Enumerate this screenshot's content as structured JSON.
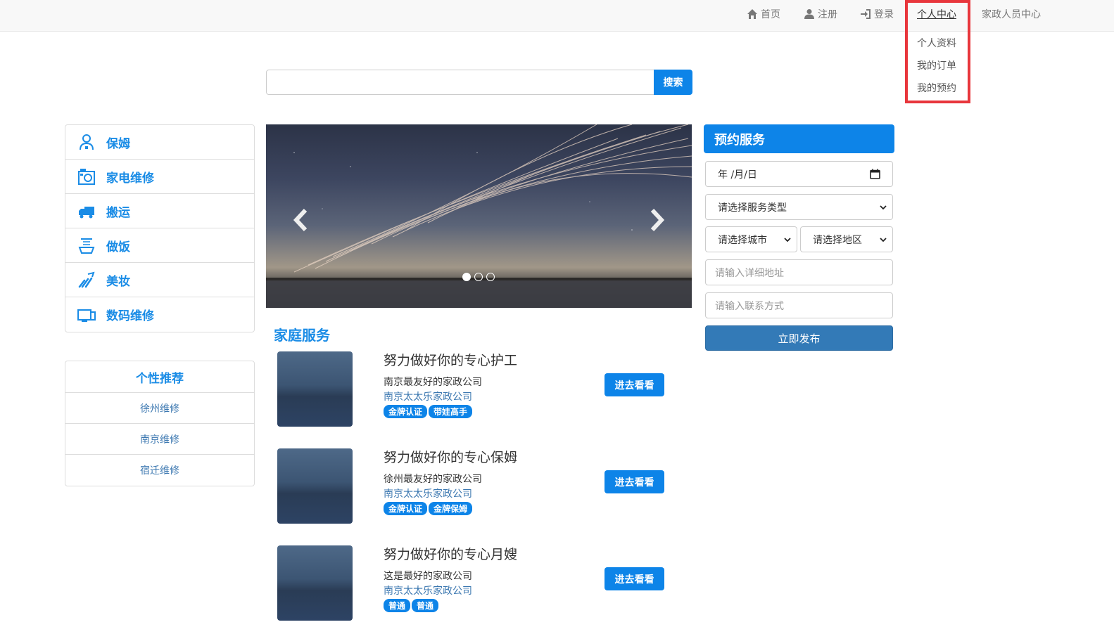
{
  "nav": {
    "home": "首页",
    "register": "注册",
    "login": "登录",
    "personal_center": "个人中心",
    "staff_center": "家政人员中心",
    "dropdown": [
      "个人资料",
      "我的订单",
      "我的预约"
    ]
  },
  "search": {
    "value": "",
    "button": "搜索"
  },
  "categories": [
    {
      "label": "保姆",
      "icon": "nanny-icon"
    },
    {
      "label": "家电维修",
      "icon": "appliance-repair-icon"
    },
    {
      "label": "搬运",
      "icon": "moving-truck-icon"
    },
    {
      "label": "做饭",
      "icon": "cooking-icon"
    },
    {
      "label": "美妆",
      "icon": "makeup-icon"
    },
    {
      "label": "数码维修",
      "icon": "digital-repair-icon"
    }
  ],
  "recommend": {
    "title": "个性推荐",
    "items": [
      "徐州维修",
      "南京维修",
      "宿迁维修"
    ]
  },
  "carousel": {
    "slide_count": 3,
    "active_index": 0
  },
  "services": {
    "title": "家庭服务",
    "items": [
      {
        "title": "努力做好你的专心护工",
        "desc": "南京最友好的家政公司",
        "company": "南京太太乐家政公司",
        "tags": [
          "金牌认证",
          "带娃高手"
        ],
        "button": "进去看看"
      },
      {
        "title": "努力做好你的专心保姆",
        "desc": "徐州最友好的家政公司",
        "company": "南京太太乐家政公司",
        "tags": [
          "金牌认证",
          "金牌保姆"
        ],
        "button": "进去看看"
      },
      {
        "title": "努力做好你的专心月嫂",
        "desc": "这是最好的家政公司",
        "company": "南京太太乐家政公司",
        "tags": [
          "普通",
          "普通"
        ],
        "button": "进去看看"
      }
    ]
  },
  "booking": {
    "title": "预约服务",
    "date_placeholder": "年 /月/日",
    "service_type": "请选择服务类型",
    "city": "请选择城市",
    "area": "请选择地区",
    "address_placeholder": "请输入详细地址",
    "contact_placeholder": "请输入联系方式",
    "submit": "立即发布"
  },
  "colors": {
    "accent": "#0d84e8",
    "link": "#3b77b0",
    "highlight": "#e8363c",
    "submit": "#337ab7"
  }
}
